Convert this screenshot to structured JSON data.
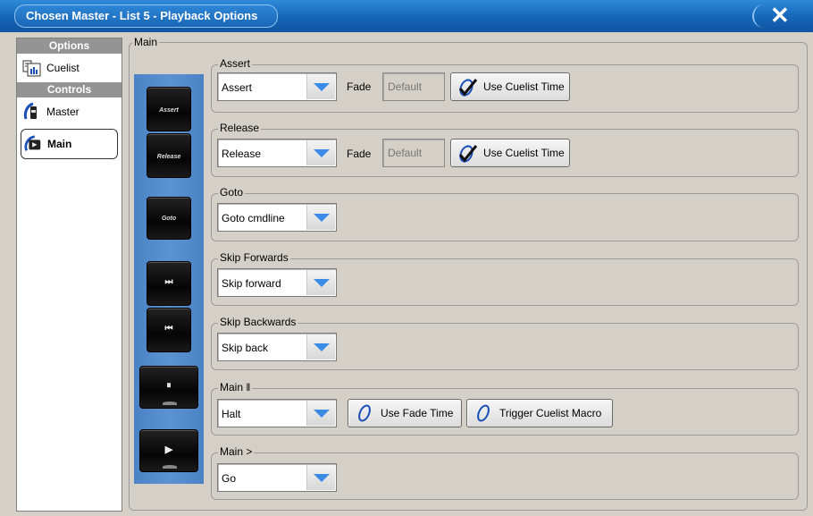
{
  "window": {
    "title": "Chosen Master - List 5 - Playback Options",
    "close_glyph": "✕"
  },
  "sidebar": {
    "options_header": "Options",
    "controls_header": "Controls",
    "items": [
      {
        "label": "Cuelist",
        "icon": "cuelist-icon"
      },
      {
        "label": "Master",
        "icon": "master-fader-icon"
      },
      {
        "label": "Main",
        "icon": "main-playback-icon",
        "selected": true
      }
    ]
  },
  "main": {
    "legend": "Main",
    "hardware_buttons": [
      {
        "label": "Assert"
      },
      {
        "label": "Release"
      },
      {
        "label": "Goto"
      },
      {
        "glyph": "⏭"
      },
      {
        "glyph": "⏮"
      },
      {
        "glyph": "⏸"
      },
      {
        "glyph": "▶"
      }
    ],
    "sections": {
      "assert": {
        "legend": "Assert",
        "value": "Assert",
        "fade_label": "Fade",
        "fade_value": "Default",
        "button": "Use Cuelist Time"
      },
      "release": {
        "legend": "Release",
        "value": "Release",
        "fade_label": "Fade",
        "fade_value": "Default",
        "button": "Use Cuelist Time"
      },
      "goto": {
        "legend": "Goto",
        "value": "Goto cmdline"
      },
      "skip_forwards": {
        "legend": "Skip Forwards",
        "value": "Skip forward"
      },
      "skip_backwards": {
        "legend": "Skip Backwards",
        "value": "Skip back"
      },
      "main_pause": {
        "legend": "Main ‖",
        "value": "Halt",
        "button1": "Use Fade Time",
        "button2": "Trigger Cuelist Macro"
      },
      "main_go": {
        "legend": "Main >",
        "value": "Go"
      }
    }
  },
  "colors": {
    "title_bar": "#1565b8",
    "panel_blue": "#5b93d2",
    "dropdown_arrow": "#3a8ae6",
    "check_blue": "#1a4fb8"
  }
}
